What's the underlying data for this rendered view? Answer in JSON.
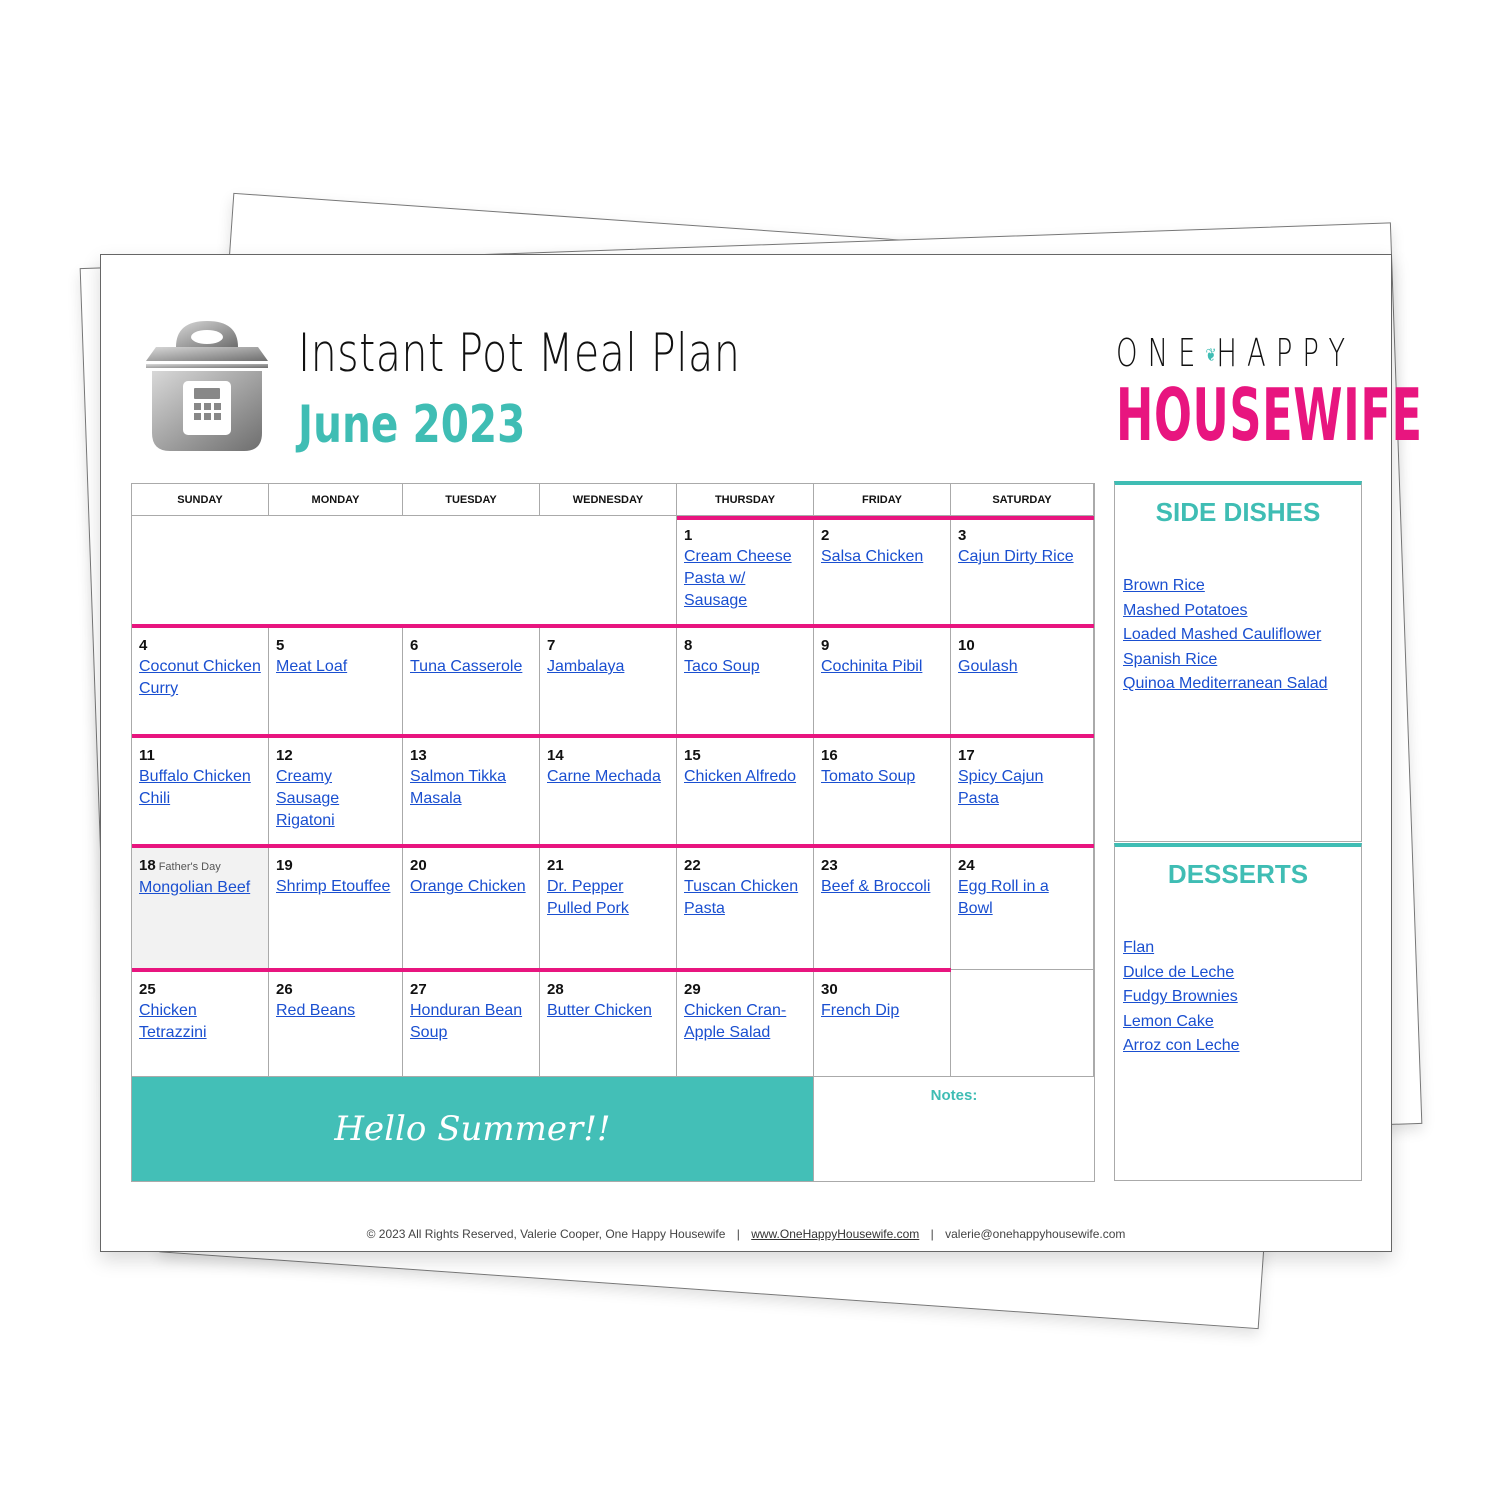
{
  "header": {
    "title": "Instant Pot Meal Plan",
    "subtitle": "June 2023",
    "logo_top_left": "ONE",
    "logo_top_right": "HAPPY",
    "logo_bottom": "HOUSEWIFE",
    "icon": "instant-pot-icon"
  },
  "colors": {
    "pink": "#e8157f",
    "teal": "#3fbdb4",
    "link_blue": "#1a4fd0"
  },
  "calendar": {
    "weekdays": [
      "SUNDAY",
      "MONDAY",
      "TUESDAY",
      "WEDNESDAY",
      "THURSDAY",
      "FRIDAY",
      "SATURDAY"
    ],
    "days": [
      {
        "day": "1",
        "meal": "Cream Cheese Pasta w/ Sausage"
      },
      {
        "day": "2",
        "meal": "Salsa Chicken"
      },
      {
        "day": "3",
        "meal": "Cajun Dirty Rice"
      },
      {
        "day": "4",
        "meal": "Coconut Chicken Curry"
      },
      {
        "day": "5",
        "meal": "Meat Loaf"
      },
      {
        "day": "6",
        "meal": "Tuna Casserole"
      },
      {
        "day": "7",
        "meal": "Jambalaya"
      },
      {
        "day": "8",
        "meal": "Taco Soup"
      },
      {
        "day": "9",
        "meal": "Cochinita Pibil"
      },
      {
        "day": "10",
        "meal": "Goulash"
      },
      {
        "day": "11",
        "meal": "Buffalo Chicken Chili"
      },
      {
        "day": "12",
        "meal": "Creamy Sausage Rigatoni"
      },
      {
        "day": "13",
        "meal": "Salmon Tikka Masala"
      },
      {
        "day": "14",
        "meal": "Carne Mechada"
      },
      {
        "day": "15",
        "meal": "Chicken Alfredo"
      },
      {
        "day": "16",
        "meal": "Tomato Soup"
      },
      {
        "day": "17",
        "meal": "Spicy Cajun Pasta"
      },
      {
        "day": "18",
        "meal": "Mongolian Beef",
        "note": "Father's Day"
      },
      {
        "day": "19",
        "meal": "Shrimp Etouffee"
      },
      {
        "day": "20",
        "meal": "Orange Chicken"
      },
      {
        "day": "21",
        "meal": "Dr. Pepper Pulled Pork"
      },
      {
        "day": "22",
        "meal": "Tuscan Chicken Pasta"
      },
      {
        "day": "23",
        "meal": "Beef & Broccoli"
      },
      {
        "day": "24",
        "meal": "Egg Roll in a Bowl"
      },
      {
        "day": "25",
        "meal": "Chicken Tetrazzini"
      },
      {
        "day": "26",
        "meal": "Red Beans"
      },
      {
        "day": "27",
        "meal": "Honduran Bean Soup"
      },
      {
        "day": "28",
        "meal": "Butter Chicken"
      },
      {
        "day": "29",
        "meal": "Chicken Cran-Apple Salad"
      },
      {
        "day": "30",
        "meal": "French Dip"
      }
    ],
    "banner": "Hello Summer!!",
    "notes_label": "Notes:"
  },
  "side_dishes": {
    "title": "SIDE DISHES",
    "items": [
      "Brown Rice",
      "Mashed Potatoes",
      "Loaded Mashed Cauliflower",
      "Spanish Rice",
      "Quinoa Mediterranean Salad"
    ]
  },
  "desserts": {
    "title": "DESSERTS",
    "items": [
      "Flan",
      "Dulce de Leche",
      "Fudgy Brownies",
      "Lemon Cake",
      "Arroz con Leche"
    ]
  },
  "footer": {
    "copyright": "© 2023 All Rights Reserved, Valerie Cooper, One Happy Housewife",
    "website": "www.OneHappyHousewife.com",
    "email": "valerie@onehappyhousewife.com",
    "separator": "|"
  }
}
